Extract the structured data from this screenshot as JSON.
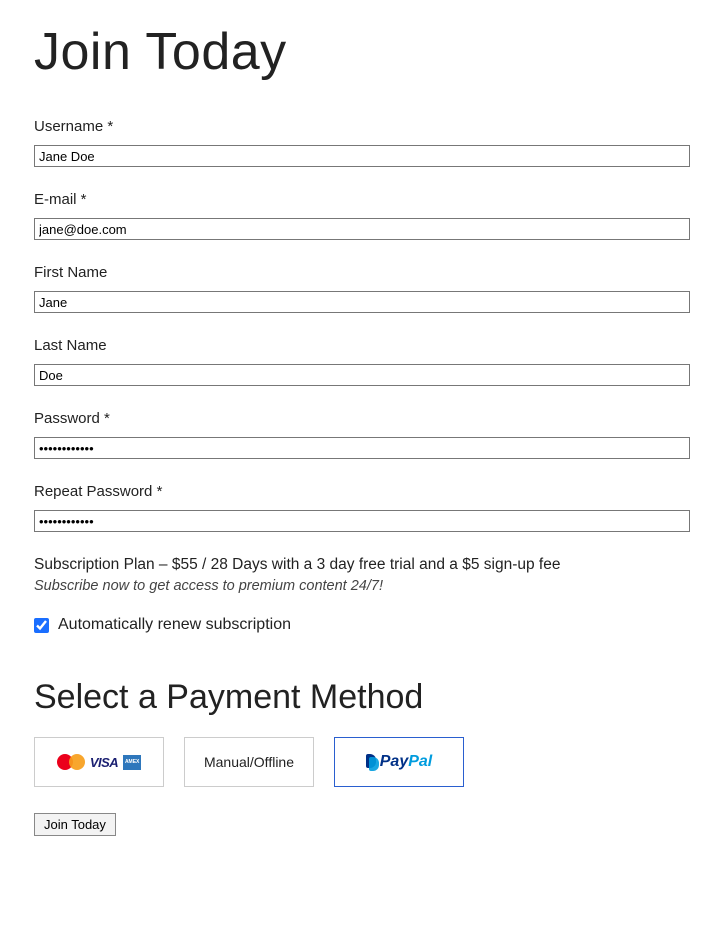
{
  "header": {
    "title": "Join Today"
  },
  "form": {
    "username": {
      "label": "Username *",
      "value": "Jane Doe"
    },
    "email": {
      "label": "E-mail *",
      "value": "jane@doe.com"
    },
    "first_name": {
      "label": "First Name",
      "value": "Jane"
    },
    "last_name": {
      "label": "Last Name",
      "value": "Doe"
    },
    "password": {
      "label": "Password *",
      "value": "••••••••••••"
    },
    "repeat_password": {
      "label": "Repeat Password *",
      "value": "••••••••••••"
    }
  },
  "plan": {
    "line": "Subscription Plan – $55 / 28 Days with a 3 day free trial and a $5 sign-up fee",
    "description": "Subscribe now to get access to premium content 24/7!"
  },
  "auto_renew": {
    "label": "Automatically renew subscription",
    "checked": true
  },
  "payment": {
    "heading": "Select a Payment Method",
    "options": {
      "cards": {
        "visa_label": "VISA",
        "amex_label": "AMEX"
      },
      "manual": {
        "label": "Manual/Offline"
      },
      "paypal": {
        "pay": "Pay",
        "pal": "Pal",
        "selected": true
      }
    }
  },
  "submit": {
    "label": "Join Today"
  }
}
